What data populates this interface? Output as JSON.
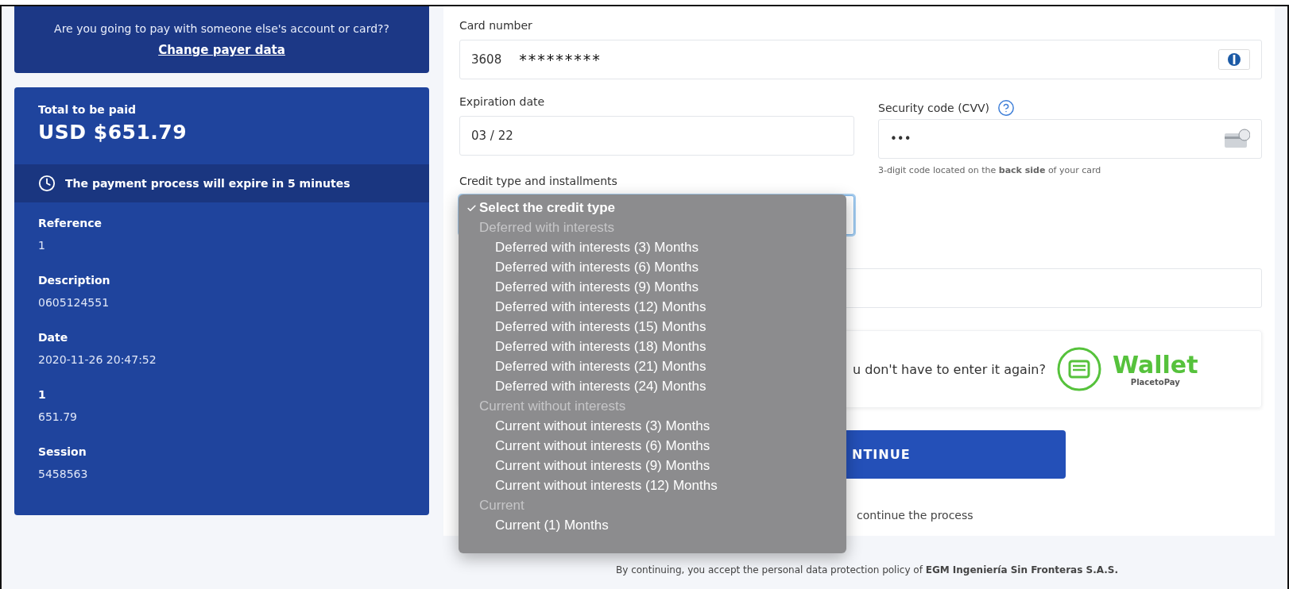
{
  "payer_notice": {
    "question": "Are you going to pay with someone else's account or card??",
    "link": "Change payer data"
  },
  "summary": {
    "total_label": "Total to be paid",
    "total_amount": "USD $651.79",
    "expiry_notice": "The payment process will expire in 5 minutes",
    "details": [
      {
        "label": "Reference",
        "value": "1"
      },
      {
        "label": "Description",
        "value": "0605124551"
      },
      {
        "label": "Date",
        "value": "2020-11-26 20:47:52"
      },
      {
        "label": "1",
        "value": "651.79"
      },
      {
        "label": "Session",
        "value": "5458563"
      }
    ]
  },
  "form": {
    "card_number": {
      "label": "Card number",
      "prefix": "3608",
      "masked": "*********"
    },
    "expiration": {
      "label": "Expiration date",
      "value": "03 / 22"
    },
    "cvv": {
      "label": "Security code (CVV)",
      "value": "•••",
      "hint": "3-digit code located on the **back side** of your card"
    },
    "credit_type": {
      "label": "Credit type and installments"
    },
    "wallet": {
      "text": "u don't have to enter it again?",
      "brand": "Wallet",
      "sub": "PlacetoPay"
    },
    "continue_button": "NTINUE",
    "note": "continue the process"
  },
  "dropdown": {
    "items": [
      {
        "kind": "option",
        "label": "Select the credit type",
        "selected": true
      },
      {
        "kind": "group",
        "label": "Deferred with interests",
        "children": [
          {
            "label": "Deferred with interests (3) Months",
            "selected": false
          },
          {
            "label": "Deferred with interests (6) Months",
            "selected": false
          },
          {
            "label": "Deferred with interests (9) Months",
            "selected": false
          },
          {
            "label": "Deferred with interests (12) Months",
            "selected": false
          },
          {
            "label": "Deferred with interests (15) Months",
            "selected": false
          },
          {
            "label": "Deferred with interests (18) Months",
            "selected": false
          },
          {
            "label": "Deferred with interests (21) Months",
            "selected": false
          },
          {
            "label": "Deferred with interests (24) Months",
            "selected": false
          }
        ]
      },
      {
        "kind": "group",
        "label": "Current without interests",
        "children": [
          {
            "label": "Current without interests (3) Months",
            "selected": false
          },
          {
            "label": "Current without interests (6) Months",
            "selected": false
          },
          {
            "label": "Current without interests (9) Months",
            "selected": false
          },
          {
            "label": "Current without interests (12) Months",
            "selected": false
          }
        ]
      },
      {
        "kind": "group",
        "label": "Current",
        "children": [
          {
            "label": "Current (1) Months",
            "selected": false
          }
        ]
      }
    ]
  },
  "footer": "By continuing, you accept the personal data protection policy of **EGM Ingeniería Sin Fronteras S.A.S.**"
}
